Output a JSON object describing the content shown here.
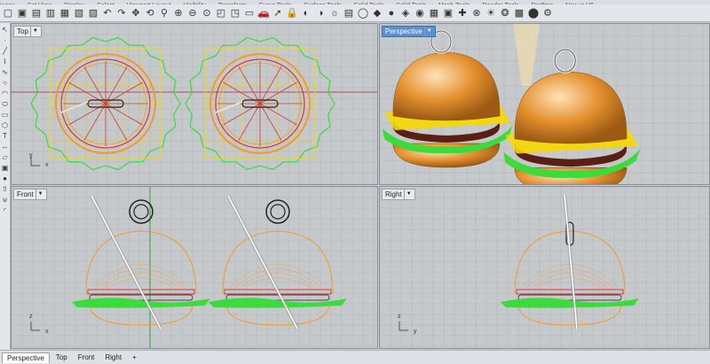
{
  "menu_tabs": [
    "ianes",
    "Set View",
    "Display",
    "Select",
    "Viewport Layout",
    "Visibility",
    "Transform",
    "Curve Tools",
    "Surface Tools",
    "Solid Tools",
    "Solid Tools",
    "Mesh Tools",
    "Render Tools",
    "Drafting",
    "New in V6"
  ],
  "toolbar_icons": [
    "new-file-icon",
    "open-icon",
    "save-icon",
    "print-icon",
    "import-icon",
    "copy-icon",
    "paste-icon",
    "undo-icon",
    "redo-icon",
    "pan-icon",
    "rotate-icon",
    "zoom-icon",
    "zoom-window-icon",
    "zoom-extents-icon",
    "zoom-selected-icon",
    "view-icon",
    "named-views-icon",
    "viewport-icon",
    "car-icon",
    "select-icon",
    "lock-icon",
    "show-icon",
    "hide-icon",
    "lightbulb-icon",
    "layers-icon",
    "circle-icon",
    "render-icon",
    "sphere-icon",
    "materials-icon",
    "color-icon",
    "grid-icon",
    "box-icon",
    "snap-icon",
    "osnap-icon",
    "sun-icon",
    "environment-icon",
    "texture-icon",
    "ball-icon",
    "settings-icon"
  ],
  "left_tools": [
    "arrow",
    "point",
    "line",
    "polyline",
    "curve",
    "circle",
    "arc",
    "ellipse",
    "rect",
    "polygon",
    "text",
    "dim",
    "surface",
    "box",
    "sphere",
    "extrude",
    "boolean",
    "fillet"
  ],
  "viewports": {
    "top": {
      "label": "Top",
      "x_axis": "x",
      "y_axis": "y"
    },
    "perspective": {
      "label": "Perspective"
    },
    "front": {
      "label": "Front",
      "x_axis": "x",
      "y_axis": "z"
    },
    "right": {
      "label": "Right",
      "x_axis": "y",
      "y_axis": "z"
    }
  },
  "bottom_tabs": [
    "Perspective",
    "Top",
    "Front",
    "Right"
  ],
  "add_tab_icon": "plus-icon",
  "colors": {
    "grid": "#aeb3b8",
    "lettuce": "#3adb3a",
    "bun": "#f39a27",
    "yellow": "#f5d800",
    "red": "#d8362f",
    "axis_red": "#b22222",
    "axis_green": "#228b22",
    "active_tab": "#5b8fd6"
  }
}
